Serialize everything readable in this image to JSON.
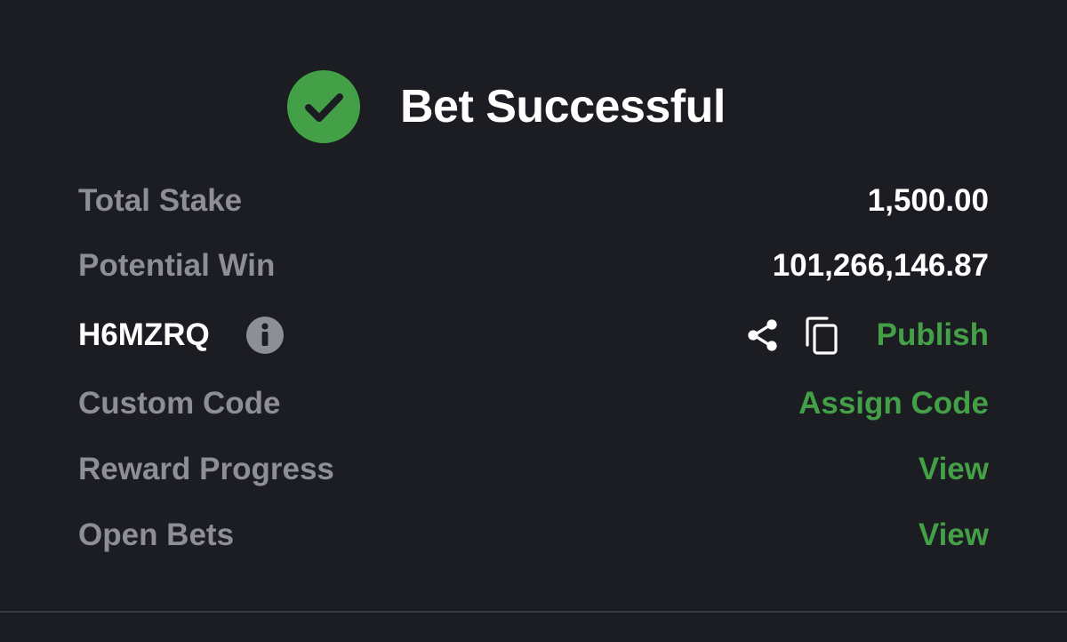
{
  "header": {
    "title": "Bet Successful",
    "icon": "check-circle-icon",
    "icon_color": "#43a047"
  },
  "summary": {
    "total_stake": {
      "label": "Total Stake",
      "value": "1,500.00"
    },
    "potential_win": {
      "label": "Potential Win",
      "value": "101,266,146.87"
    },
    "booking": {
      "code": "H6MZRQ",
      "info_icon": "info-icon",
      "share_icon": "share-icon",
      "copy_icon": "copy-icon",
      "publish_label": "Publish"
    },
    "custom_code": {
      "label": "Custom Code",
      "action": "Assign Code"
    },
    "reward_progress": {
      "label": "Reward Progress",
      "action": "View"
    },
    "open_bets": {
      "label": "Open Bets",
      "action": "View"
    }
  },
  "colors": {
    "background": "#1c1d22",
    "accent_green": "#43a047",
    "label_gray": "#8d8e96",
    "value_white": "#ffffff",
    "divider": "#3a3b42"
  }
}
